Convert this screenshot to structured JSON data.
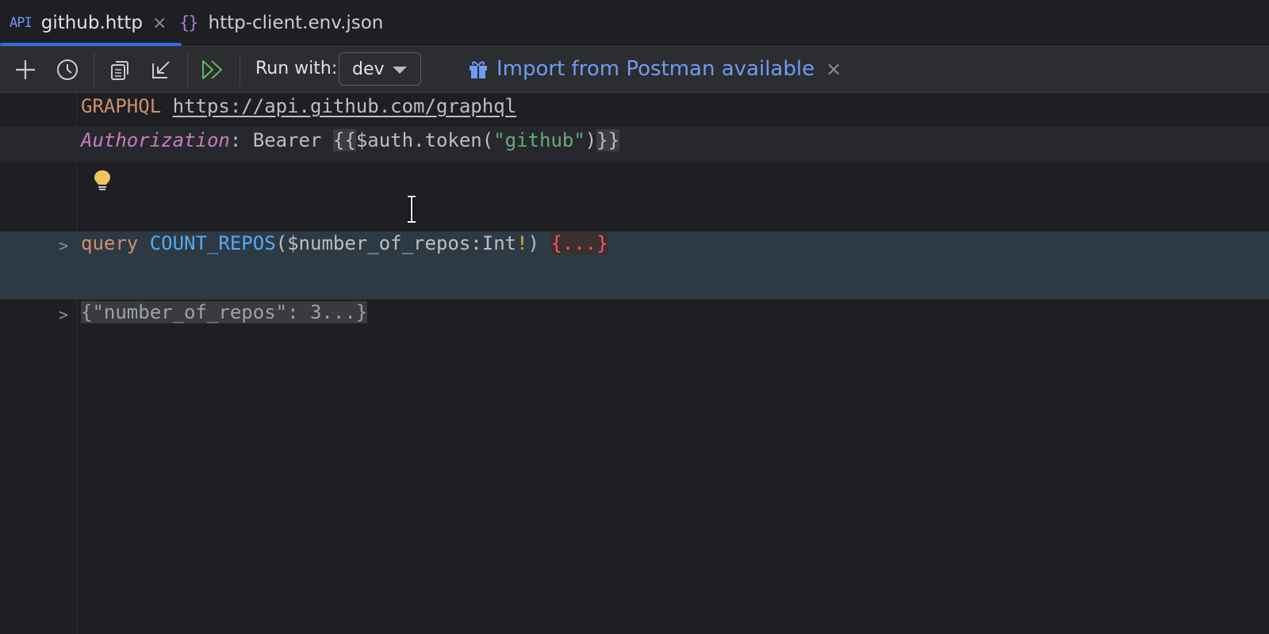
{
  "tabs": [
    {
      "badge": "API",
      "label": "github.http",
      "active": true,
      "close": "×"
    },
    {
      "icon": "{}",
      "label": "http-client.env.json",
      "active": false
    }
  ],
  "toolbar": {
    "run_with_label": "Run with:",
    "env_selected": "dev",
    "import_text": "Import from Postman available",
    "import_close": "×"
  },
  "editor": {
    "line1": {
      "method": "GRAPHQL",
      "url": "https://api.github.com/graphql"
    },
    "line2": {
      "header_name": "Authorization",
      "colon": ": ",
      "bearer": "Bearer ",
      "open": "{{",
      "expr_a": "$auth.token(",
      "expr_str": "\"github\"",
      "expr_b": ")",
      "close": "}}"
    },
    "query": {
      "keyword": "query",
      "name": "COUNT_REPOS",
      "args_a": "($number_of_repos:Int",
      "bang": "!",
      "args_b": ") ",
      "folded": "{...}"
    },
    "variables_folded": "{\"number_of_repos\": 3...}"
  },
  "colors": {
    "accent": "#3574f0",
    "link": "#6f9bf2",
    "run_green": "#5fb865",
    "bulb": "#f2c55c"
  }
}
